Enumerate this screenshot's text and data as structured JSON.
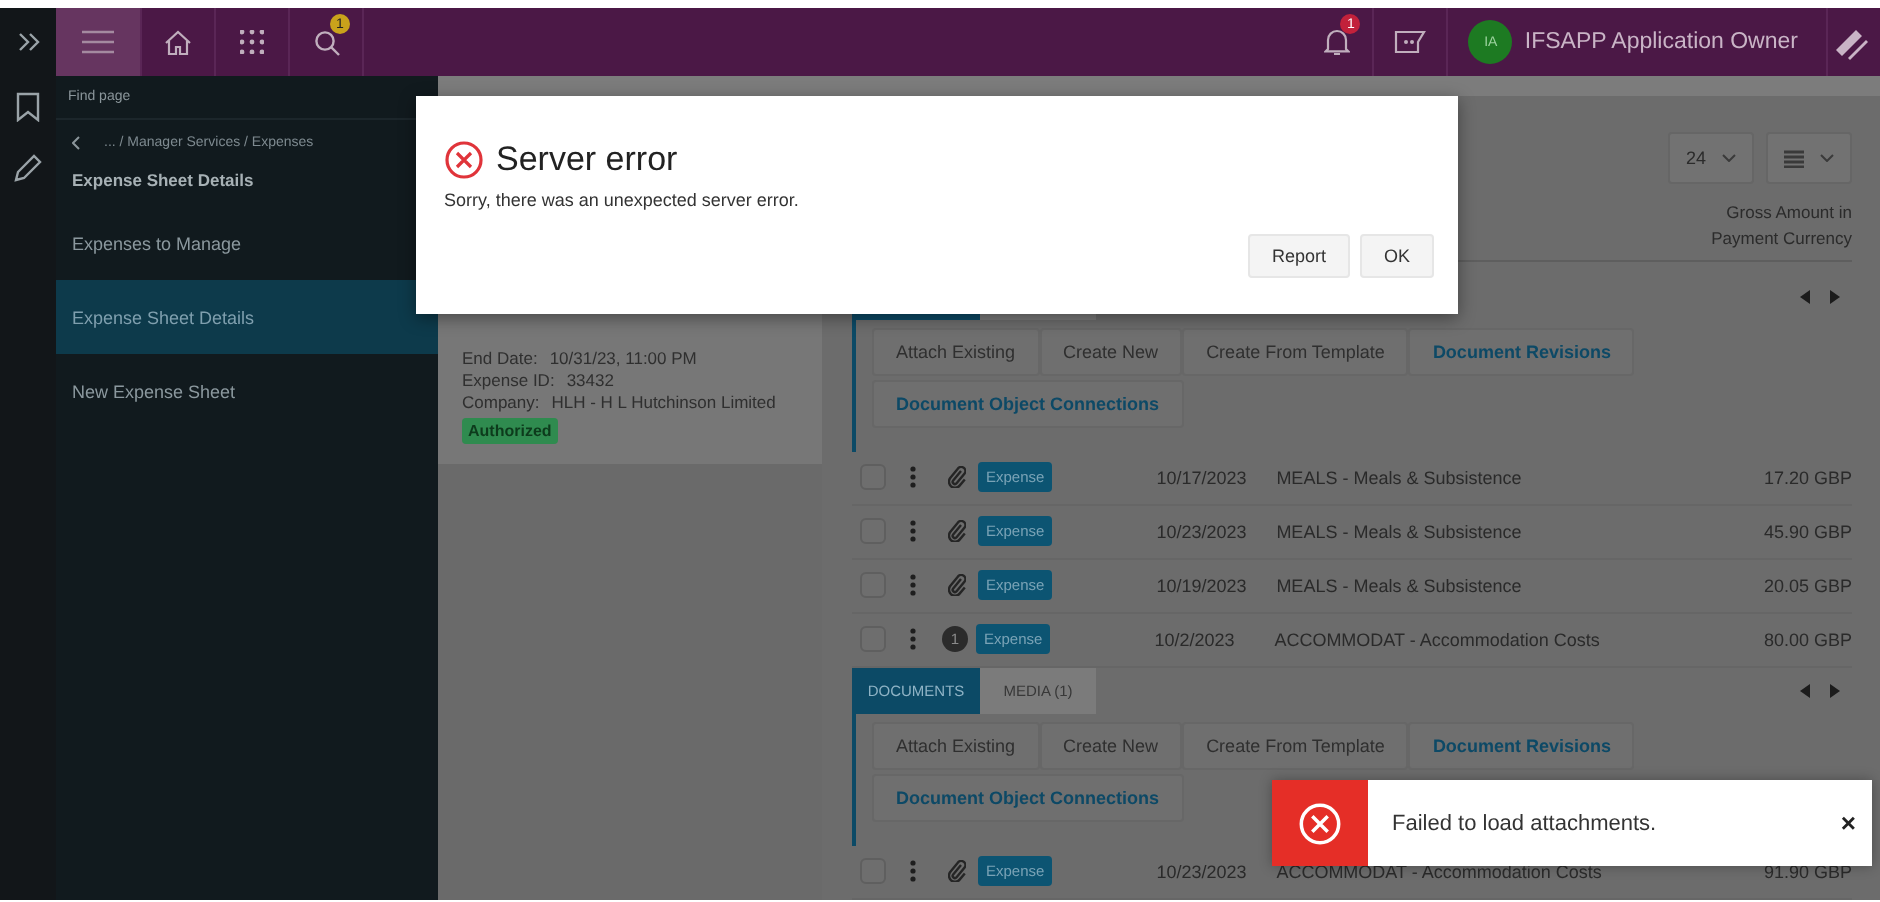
{
  "header": {
    "search_badge": "1",
    "notification_badge": "1",
    "avatar": "IA",
    "user_name": "IFSAPP Application Owner"
  },
  "sidebar": {
    "search_placeholder": "Find page",
    "breadcrumb": "... / Manager Services / Expenses",
    "title": "Expense Sheet Details",
    "items": [
      {
        "label": "Expenses to Manage",
        "selected": false
      },
      {
        "label": "Expense Sheet Details",
        "selected": true
      },
      {
        "label": "New Expense Sheet",
        "selected": false
      }
    ]
  },
  "summary": {
    "fields": [
      {
        "label": "End Date:",
        "value": "10/31/23, 11:00 PM"
      },
      {
        "label": "Expense ID:",
        "value": "33432"
      },
      {
        "label": "Company:",
        "value": "HLH - H L Hutchinson Limited"
      }
    ],
    "status": "Authorized"
  },
  "lines": {
    "page_size": "24",
    "column_header": "Gross Amount in Payment Currency",
    "blocks": [
      {
        "kind": "attachments",
        "tabs": [
          {
            "selected": true
          },
          {
            "selected": false
          }
        ],
        "actions": [
          {
            "label": "Attach Existing",
            "kind": "plain"
          },
          {
            "label": "Create New",
            "kind": "plain"
          },
          {
            "label": "Create From Template",
            "kind": "plain"
          },
          {
            "label": "Document Revisions",
            "kind": "link"
          },
          {
            "label": "Document Object Connections",
            "kind": "link"
          }
        ]
      },
      {
        "kind": "line",
        "checked": false,
        "marker": {
          "kind": "clip"
        },
        "type": "Expense",
        "date": "10/17/2023",
        "description": "MEALS - Meals & Subsistence",
        "amount": "17.20 GBP"
      },
      {
        "kind": "line",
        "checked": false,
        "marker": {
          "kind": "clip"
        },
        "type": "Expense",
        "date": "10/23/2023",
        "description": "MEALS - Meals & Subsistence",
        "amount": "45.90 GBP"
      },
      {
        "kind": "line",
        "checked": false,
        "marker": {
          "kind": "clip"
        },
        "type": "Expense",
        "date": "10/19/2023",
        "description": "MEALS - Meals & Subsistence",
        "amount": "20.05 GBP"
      },
      {
        "kind": "line",
        "checked": false,
        "marker": {
          "kind": "count",
          "text": "1"
        },
        "type": "Expense",
        "date": "10/2/2023",
        "description": "ACCOMMODAT - Accommodation Costs",
        "amount": "80.00 GBP"
      },
      {
        "kind": "attachments",
        "tabs": [
          {
            "label": "DOCUMENTS",
            "selected": true
          },
          {
            "label": "MEDIA (1)",
            "selected": false
          }
        ],
        "actions": [
          {
            "label": "Attach Existing",
            "kind": "plain"
          },
          {
            "label": "Create New",
            "kind": "plain"
          },
          {
            "label": "Create From Template",
            "kind": "plain"
          },
          {
            "label": "Document Revisions",
            "kind": "link"
          },
          {
            "label": "Document Object Connections",
            "kind": "link"
          }
        ]
      },
      {
        "kind": "line",
        "checked": false,
        "marker": {
          "kind": "clip"
        },
        "type": "Expense",
        "date": "10/23/2023",
        "description": "ACCOMMODAT - Accommodation Costs",
        "amount": "91.90 GBP"
      }
    ]
  },
  "dialog": {
    "title": "Server error",
    "message": "Sorry, there was an unexpected server error.",
    "buttons": [
      "Report",
      "OK"
    ]
  },
  "toast": {
    "message": "Failed to load attachments.",
    "close": "×"
  }
}
